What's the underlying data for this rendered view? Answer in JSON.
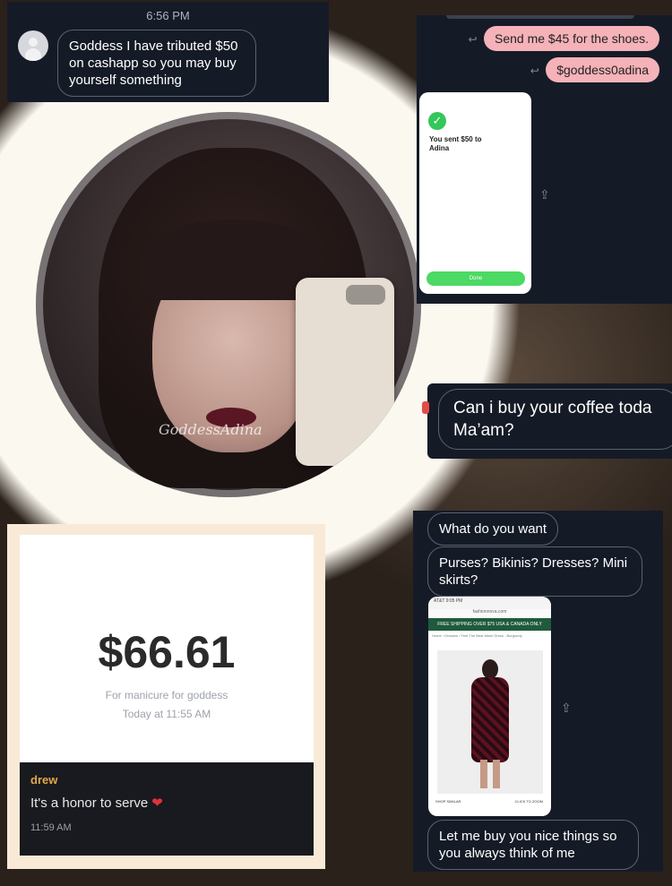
{
  "collage_watermark": "GoddessAdina",
  "card1": {
    "time": "6:56 PM",
    "message": "Goddess I have tributed $50 on cashapp so you may buy yourself something"
  },
  "card2": {
    "reply1": "Send me $45 for the shoes.",
    "reply2": "$goddess0adina",
    "receipt_text": "You sent $50 to Adina",
    "done_label": "Done"
  },
  "card3": {
    "message": "Can i buy your coffee toda Ma’am?"
  },
  "card4": {
    "amount": "$66.61",
    "note": "For manicure for goddess",
    "when": "Today at 11:55 AM",
    "sender": "drew",
    "message": "It's a honor to serve",
    "time": "11:59 AM"
  },
  "card5": {
    "b1": "What do you want",
    "b2": "Purses? Bikinis? Dresses? Mini skirts?",
    "shot_status": "AT&T  9:05 PM",
    "shot_url": "fashionnova.com",
    "shot_promo": "FREE SHIPPING OVER $75 USA & CANADA ONLY",
    "shot_crumb": "Home › Dresses › Feel The Beat Mesh Dress - Burgundy",
    "shop_similar": "SHOP SIMILAR",
    "click_zoom": "CLICK TO ZOOM",
    "b3": "Let me buy you nice things so you always think of me"
  },
  "icons": {
    "reply": "↩",
    "share": "⇪",
    "check": "✓",
    "heart": "❤"
  }
}
